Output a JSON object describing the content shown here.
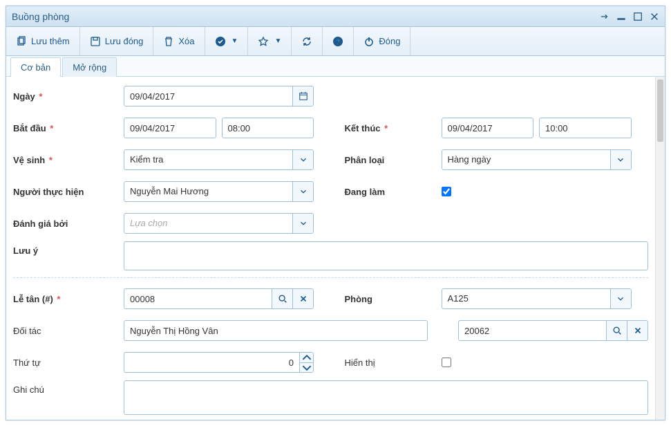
{
  "window": {
    "title": "Buồng phòng"
  },
  "toolbar": {
    "save_more": "Lưu thêm",
    "save_close": "Lưu đóng",
    "delete": "Xóa",
    "close": "Đóng"
  },
  "tabs": {
    "basic": "Cơ bản",
    "extended": "Mở rộng"
  },
  "labels": {
    "date": "Ngày",
    "start": "Bắt đầu",
    "end": "Kết thúc",
    "hygiene": "Vệ sinh",
    "category": "Phân loại",
    "performer": "Người thực hiện",
    "doing": "Đang làm",
    "rated_by": "Đánh giá bởi",
    "note": "Lưu ý",
    "reception": "Lễ tân (#)",
    "room": "Phòng",
    "partner": "Đối tác",
    "order": "Thứ tự",
    "display": "Hiển thị",
    "remark": "Ghi chú"
  },
  "values": {
    "date": "09/04/2017",
    "start_date": "09/04/2017",
    "start_time": "08:00",
    "end_date": "09/04/2017",
    "end_time": "10:00",
    "hygiene": "Kiểm tra",
    "category": "Hàng ngày",
    "performer": "Nguyễn Mai Hương",
    "doing": true,
    "rated_by_placeholder": "Lựa chọn",
    "note": "",
    "reception": "00008",
    "room": "A125",
    "partner_name": "Nguyễn Thị Hồng Vân",
    "partner_code": "20062",
    "order": "0",
    "display": false,
    "remark": ""
  }
}
